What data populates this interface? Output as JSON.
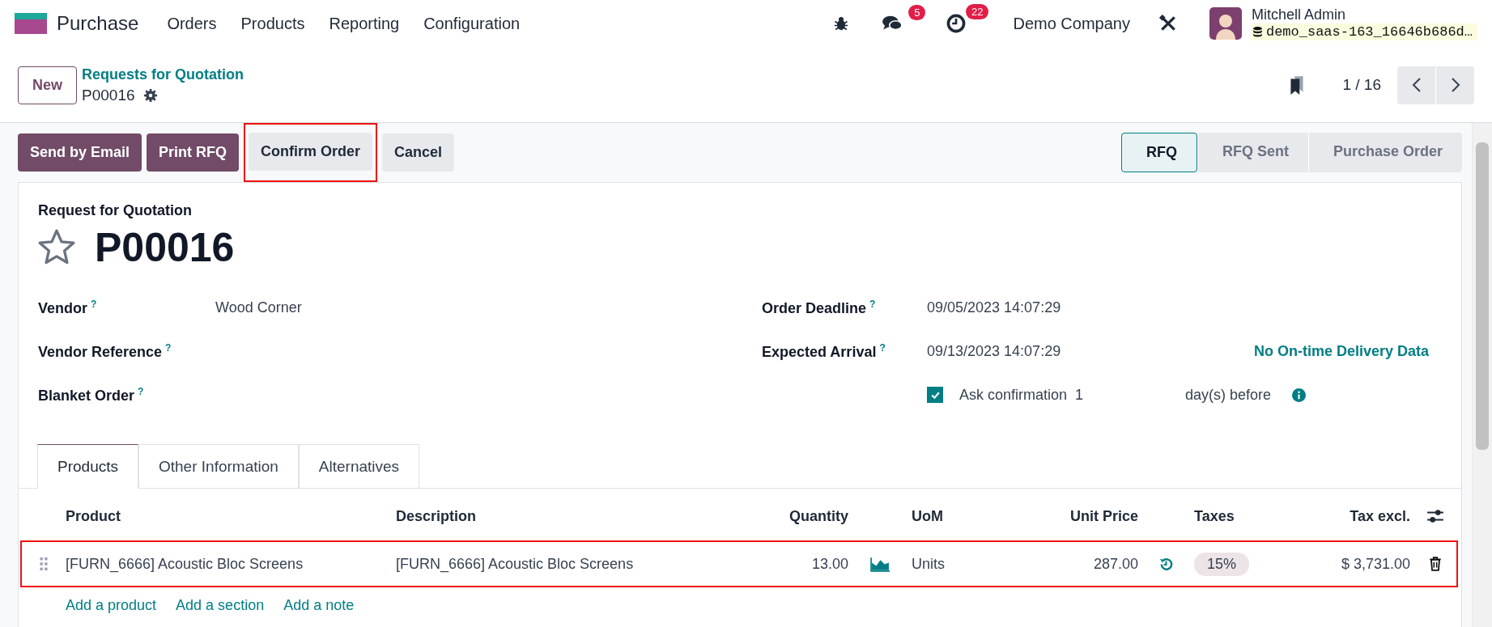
{
  "navbar": {
    "app_name": "Purchase",
    "menu": [
      "Orders",
      "Products",
      "Reporting",
      "Configuration"
    ],
    "messages_badge": "5",
    "activities_badge": "22",
    "company": "Demo Company",
    "user_name": "Mitchell Admin",
    "database": "demo_saas-163_16646b686d…"
  },
  "control_panel": {
    "new_button": "New",
    "breadcrumb": "Requests for Quotation",
    "record": "P00016",
    "pager": "1 / 16"
  },
  "action_buttons": [
    {
      "label": "Send by Email",
      "kind": "primary",
      "highlighted": false
    },
    {
      "label": "Print RFQ",
      "kind": "primary",
      "highlighted": false
    },
    {
      "label": "Confirm Order",
      "kind": "secondary",
      "highlighted": true
    },
    {
      "label": "Cancel",
      "kind": "secondary",
      "highlighted": false
    }
  ],
  "statusbar": [
    {
      "label": "RFQ",
      "selected": true
    },
    {
      "label": "RFQ Sent",
      "selected": false
    },
    {
      "label": "Purchase Order",
      "selected": false
    }
  ],
  "form": {
    "subtitle": "Request for Quotation",
    "title": "P00016",
    "favorite": false,
    "left_fields": [
      {
        "label": "Vendor",
        "help": "?",
        "value": "Wood Corner"
      },
      {
        "label": "Vendor Reference",
        "help": "?"
      },
      {
        "label": "Blanket Order",
        "help": "?"
      }
    ],
    "right_fields": [
      {
        "label": "Order Deadline",
        "help": "?",
        "value": "09/05/2023 14:07:29"
      },
      {
        "label": "Expected Arrival",
        "help": "?",
        "value": "09/13/2023 14:07:29",
        "note": "No On-time Delivery Data"
      }
    ],
    "ask_confirmation": {
      "checked": true,
      "label": "Ask confirmation",
      "days": "1",
      "suffix": "day(s) before"
    }
  },
  "tabs": [
    {
      "label": "Products",
      "selected": true
    },
    {
      "label": "Other Information",
      "selected": false
    },
    {
      "label": "Alternatives",
      "selected": false
    }
  ],
  "table": {
    "columns": [
      "Product",
      "Description",
      "Quantity",
      "UoM",
      "Unit Price",
      "Taxes",
      "Tax excl."
    ],
    "rows": [
      {
        "product": "[FURN_6666] Acoustic Bloc Screens",
        "description": "[FURN_6666] Acoustic Bloc Screens",
        "quantity": "13.00",
        "uom": "Units",
        "unit_price": "287.00",
        "taxes": "15%",
        "subtotal": "$ 3,731.00",
        "highlighted": true
      }
    ],
    "add_links": [
      "Add a product",
      "Add a section",
      "Add a note"
    ]
  }
}
